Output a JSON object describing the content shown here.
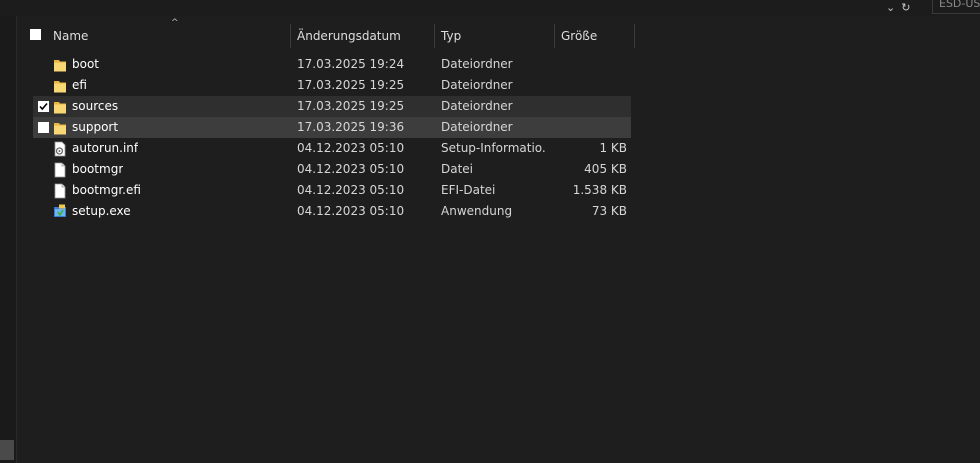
{
  "topbar": {
    "chevron": "⌄",
    "refresh": "↻",
    "search_text": "ESD-USB"
  },
  "columns": {
    "sort_indicator": "^",
    "name": "Name",
    "date": "Änderungsdatum",
    "type": "Typ",
    "size": "Größe"
  },
  "files": [
    {
      "name": "boot",
      "date": "17.03.2025 19:24",
      "type": "Dateiordner",
      "size": "",
      "icon": "folder-icon",
      "checked": false
    },
    {
      "name": "efi",
      "date": "17.03.2025 19:25",
      "type": "Dateiordner",
      "size": "",
      "icon": "folder-icon",
      "checked": false
    },
    {
      "name": "sources",
      "date": "17.03.2025 19:25",
      "type": "Dateiordner",
      "size": "",
      "icon": "folder-icon",
      "checked": true
    },
    {
      "name": "support",
      "date": "17.03.2025 19:36",
      "type": "Dateiordner",
      "size": "",
      "icon": "folder-icon",
      "checked": false
    },
    {
      "name": "autorun.inf",
      "date": "04.12.2023 05:10",
      "type": "Setup-Informatio...",
      "size": "1 KB",
      "icon": "settings-file-icon",
      "checked": false
    },
    {
      "name": "bootmgr",
      "date": "04.12.2023 05:10",
      "type": "Datei",
      "size": "405 KB",
      "icon": "file-icon",
      "checked": false
    },
    {
      "name": "bootmgr.efi",
      "date": "04.12.2023 05:10",
      "type": "EFI-Datei",
      "size": "1.538 KB",
      "icon": "file-icon",
      "checked": false
    },
    {
      "name": "setup.exe",
      "date": "04.12.2023 05:10",
      "type": "Anwendung",
      "size": "73 KB",
      "icon": "setup-app-icon",
      "checked": false
    }
  ]
}
